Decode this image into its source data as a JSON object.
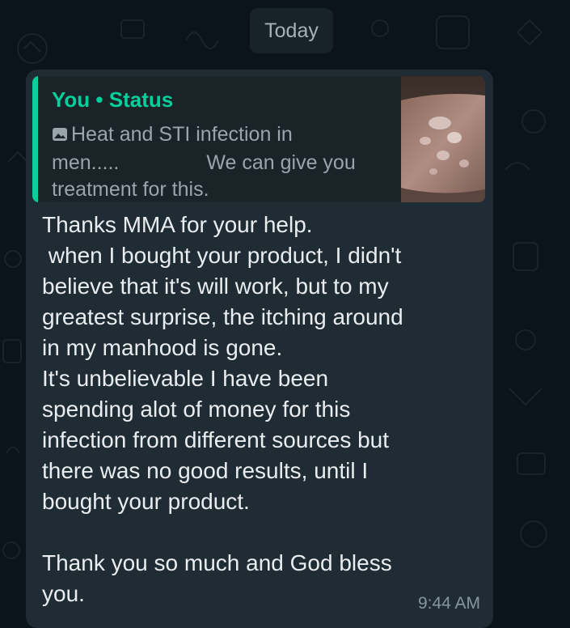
{
  "chat": {
    "date_label": "Today",
    "message": {
      "quoted": {
        "author": "You",
        "separator": "•",
        "source": "Status",
        "icon": "photo-icon",
        "text_line1": "Heat and STI infection in",
        "text_line2a": "men.....",
        "text_line2b": "We can give you",
        "text_line3": "treatment for this."
      },
      "body": "Thanks MMA for your help.\n when I bought your product, I didn't\nbelieve that it's will work, but to my\ngreatest surprise, the itching around\nin my manhood is gone.\nIt's unbelievable I have been\nspending alot of money for this\ninfection from different sources but\nthere was no good results, until I\nbought your product.\n\nThank you so much and God bless\nyou.",
      "time": "9:44 AM"
    }
  },
  "colors": {
    "background": "#0b141a",
    "bubble": "#202c33",
    "quote_background": "#1a2328",
    "accent": "#06cf9c",
    "text_primary": "#e9edef",
    "text_secondary": "#8696a0"
  }
}
